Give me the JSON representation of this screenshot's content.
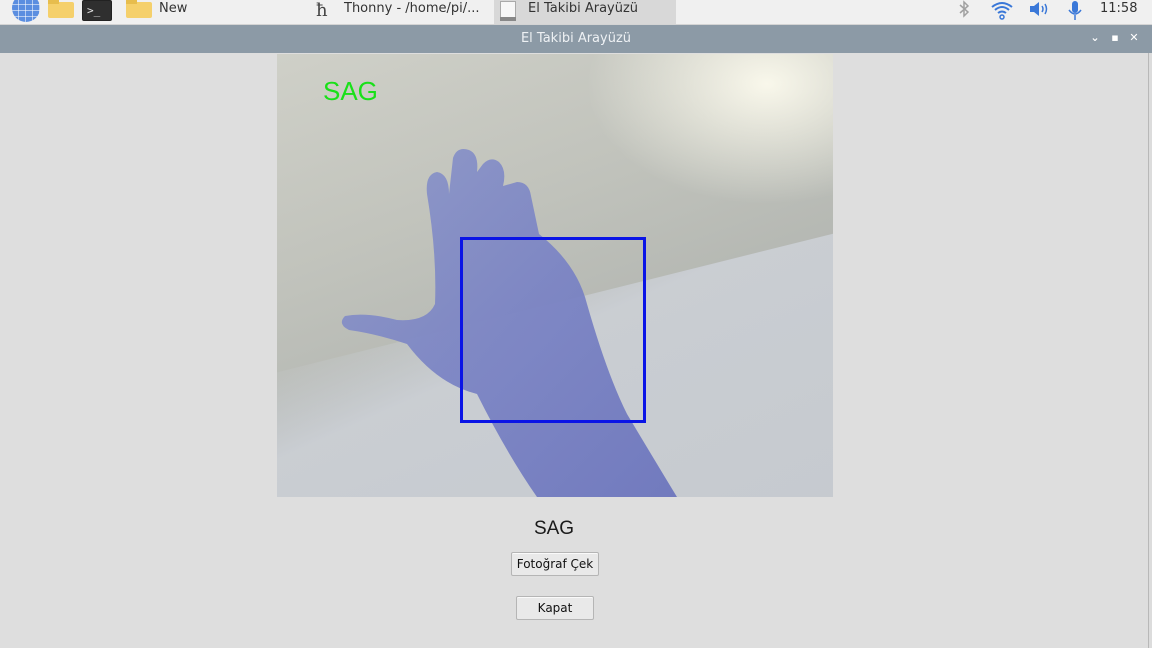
{
  "taskbar": {
    "folder_label": "New",
    "terminal_prompt": ">_",
    "tasks": [
      {
        "label": "Thonny  -  /home/pi/..."
      },
      {
        "label": "El Takibi Arayüzü"
      }
    ],
    "clock": "11:58",
    "icons": [
      "globe-icon",
      "folder-icon",
      "terminal-icon",
      "bluetooth-icon",
      "wifi-icon",
      "volume-icon",
      "microphone-icon"
    ]
  },
  "window": {
    "title": "El Takibi Arayüzü",
    "controls": [
      "minimize",
      "maximize",
      "close"
    ]
  },
  "camera": {
    "overlay_text": "SAG",
    "overlay_color": "#19e019",
    "box_color": "#0a14e6"
  },
  "result_label": "SAG",
  "buttons": {
    "photo": "Fotoğraf Çek",
    "close": "Kapat"
  }
}
